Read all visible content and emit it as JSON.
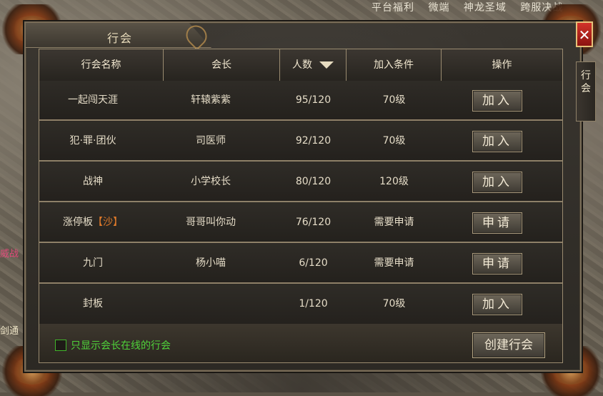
{
  "world": {
    "top_links": [
      "平台福利",
      "微端",
      "神龙圣域",
      "跨服决战"
    ],
    "left_text_1": "威战",
    "left_text_2": "剑通"
  },
  "window": {
    "title": "行会",
    "close_label": "✕",
    "side_tab_label": "行会"
  },
  "table": {
    "headers": [
      "行会名称",
      "会长",
      "人数",
      "加入条件",
      "操作"
    ],
    "rows": [
      {
        "name": "一起闯天涯",
        "tag": "",
        "leader": "轩辕紫紫",
        "members": "95/120",
        "condition": "70级",
        "action": "加入"
      },
      {
        "name": "犯·罪·团伙",
        "tag": "",
        "leader": "司医师",
        "members": "92/120",
        "condition": "70级",
        "action": "加入"
      },
      {
        "name": "战神",
        "tag": "",
        "leader": "小学校长",
        "members": "80/120",
        "condition": "120级",
        "action": "加入"
      },
      {
        "name": "涨停板",
        "tag": "【沙】",
        "leader": "哥哥叫你动",
        "members": "76/120",
        "condition": "需要申请",
        "action": "申请"
      },
      {
        "name": "九门",
        "tag": "",
        "leader": "杨小喵",
        "members": "6/120",
        "condition": "需要申请",
        "action": "申请"
      },
      {
        "name": "封板",
        "tag": "",
        "leader": "",
        "members": "1/120",
        "condition": "70级",
        "action": "加入"
      }
    ]
  },
  "footer": {
    "filter_label": "只显示会长在线的行会",
    "create_label": "创建行会"
  },
  "colors": {
    "accent_green": "#4fd23a",
    "guild_tag": "#e07a2a",
    "close_red": "#c62a22"
  }
}
